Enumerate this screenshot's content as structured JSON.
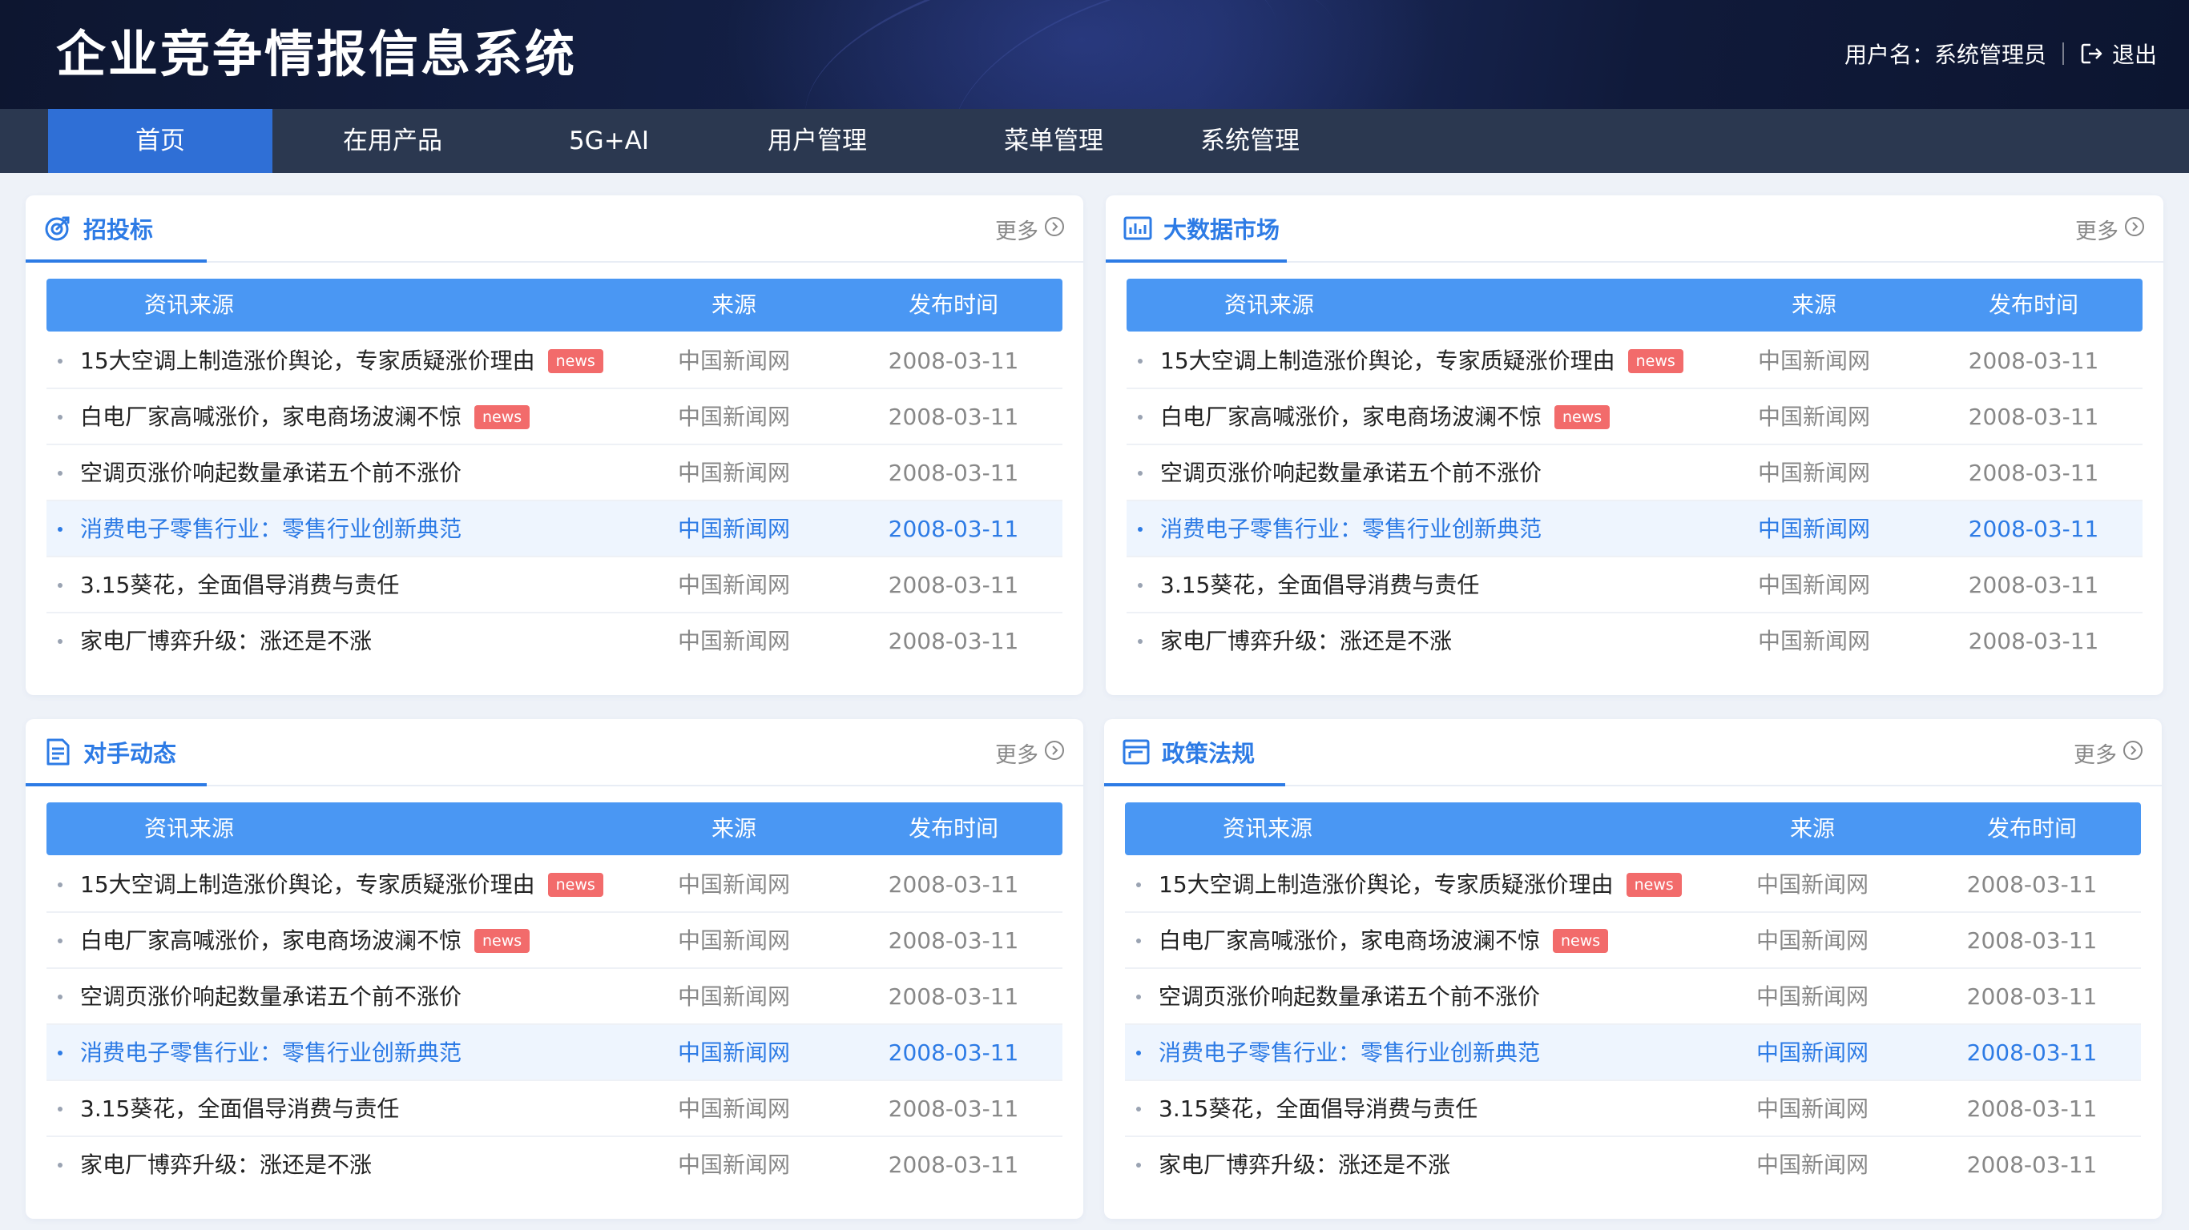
{
  "header": {
    "app_title": "企业竞争情报信息系统",
    "user_label": "用户名：系统管理员",
    "logout_label": "退出"
  },
  "nav": {
    "items": [
      {
        "label": "首页",
        "active": true
      },
      {
        "label": "在用产品",
        "active": false
      },
      {
        "label": "5G+AI",
        "active": false
      },
      {
        "label": "用户管理",
        "active": false
      },
      {
        "label": "菜单管理",
        "active": false
      },
      {
        "label": "系统管理",
        "active": false
      }
    ]
  },
  "colors": {
    "accent": "#2d7be5",
    "table_header": "#4a97f3",
    "badge": "#f26b6b",
    "nav_active": "#2f6fd6",
    "nav_bg": "#2b3850"
  },
  "panels": [
    {
      "title": "招投标",
      "icon": "target-icon",
      "more": "更多",
      "columns": [
        "资讯来源",
        "来源",
        "发布时间"
      ],
      "rows": [
        {
          "title": "15大空调上制造涨价舆论，专家质疑涨价理由",
          "badge": "news",
          "source": "中国新闻网",
          "date": "2008-03-11",
          "highlight": false
        },
        {
          "title": "白电厂家高喊涨价，家电商场波澜不惊",
          "badge": "news",
          "source": "中国新闻网",
          "date": "2008-03-11",
          "highlight": false
        },
        {
          "title": "空调页涨价响起数量承诺五个前不涨价",
          "badge": "",
          "source": "中国新闻网",
          "date": "2008-03-11",
          "highlight": false
        },
        {
          "title": "消费电子零售行业：零售行业创新典范",
          "badge": "",
          "source": "中国新闻网",
          "date": "2008-03-11",
          "highlight": true
        },
        {
          "title": "3.15葵花，全面倡导消费与责任",
          "badge": "",
          "source": "中国新闻网",
          "date": "2008-03-11",
          "highlight": false
        },
        {
          "title": "家电厂博弈升级：涨还是不涨",
          "badge": "",
          "source": "中国新闻网",
          "date": "2008-03-11",
          "highlight": false
        }
      ]
    },
    {
      "title": "大数据市场",
      "icon": "data-chart-icon",
      "more": "更多",
      "columns": [
        "资讯来源",
        "来源",
        "发布时间"
      ],
      "rows": [
        {
          "title": "15大空调上制造涨价舆论，专家质疑涨价理由",
          "badge": "news",
          "source": "中国新闻网",
          "date": "2008-03-11",
          "highlight": false
        },
        {
          "title": "白电厂家高喊涨价，家电商场波澜不惊",
          "badge": "news",
          "source": "中国新闻网",
          "date": "2008-03-11",
          "highlight": false
        },
        {
          "title": "空调页涨价响起数量承诺五个前不涨价",
          "badge": "",
          "source": "中国新闻网",
          "date": "2008-03-11",
          "highlight": false
        },
        {
          "title": "消费电子零售行业：零售行业创新典范",
          "badge": "",
          "source": "中国新闻网",
          "date": "2008-03-11",
          "highlight": true
        },
        {
          "title": "3.15葵花，全面倡导消费与责任",
          "badge": "",
          "source": "中国新闻网",
          "date": "2008-03-11",
          "highlight": false
        },
        {
          "title": "家电厂博弈升级：涨还是不涨",
          "badge": "",
          "source": "中国新闻网",
          "date": "2008-03-11",
          "highlight": false
        }
      ]
    },
    {
      "title": "对手动态",
      "icon": "document-icon",
      "more": "更多",
      "columns": [
        "资讯来源",
        "来源",
        "发布时间"
      ],
      "rows": [
        {
          "title": "15大空调上制造涨价舆论，专家质疑涨价理由",
          "badge": "news",
          "source": "中国新闻网",
          "date": "2008-03-11",
          "highlight": false
        },
        {
          "title": "白电厂家高喊涨价，家电商场波澜不惊",
          "badge": "news",
          "source": "中国新闻网",
          "date": "2008-03-11",
          "highlight": false
        },
        {
          "title": "空调页涨价响起数量承诺五个前不涨价",
          "badge": "",
          "source": "中国新闻网",
          "date": "2008-03-11",
          "highlight": false
        },
        {
          "title": "消费电子零售行业：零售行业创新典范",
          "badge": "",
          "source": "中国新闻网",
          "date": "2008-03-11",
          "highlight": true
        },
        {
          "title": "3.15葵花，全面倡导消费与责任",
          "badge": "",
          "source": "中国新闻网",
          "date": "2008-03-11",
          "highlight": false
        },
        {
          "title": "家电厂博弈升级：涨还是不涨",
          "badge": "",
          "source": "中国新闻网",
          "date": "2008-03-11",
          "highlight": false
        }
      ]
    },
    {
      "title": "政策法规",
      "icon": "window-icon",
      "more": "更多",
      "columns": [
        "资讯来源",
        "来源",
        "发布时间"
      ],
      "rows": [
        {
          "title": "15大空调上制造涨价舆论，专家质疑涨价理由",
          "badge": "news",
          "source": "中国新闻网",
          "date": "2008-03-11",
          "highlight": false
        },
        {
          "title": "白电厂家高喊涨价，家电商场波澜不惊",
          "badge": "news",
          "source": "中国新闻网",
          "date": "2008-03-11",
          "highlight": false
        },
        {
          "title": "空调页涨价响起数量承诺五个前不涨价",
          "badge": "",
          "source": "中国新闻网",
          "date": "2008-03-11",
          "highlight": false
        },
        {
          "title": "消费电子零售行业：零售行业创新典范",
          "badge": "",
          "source": "中国新闻网",
          "date": "2008-03-11",
          "highlight": true
        },
        {
          "title": "3.15葵花，全面倡导消费与责任",
          "badge": "",
          "source": "中国新闻网",
          "date": "2008-03-11",
          "highlight": false
        },
        {
          "title": "家电厂博弈升级：涨还是不涨",
          "badge": "",
          "source": "中国新闻网",
          "date": "2008-03-11",
          "highlight": false
        }
      ]
    }
  ]
}
